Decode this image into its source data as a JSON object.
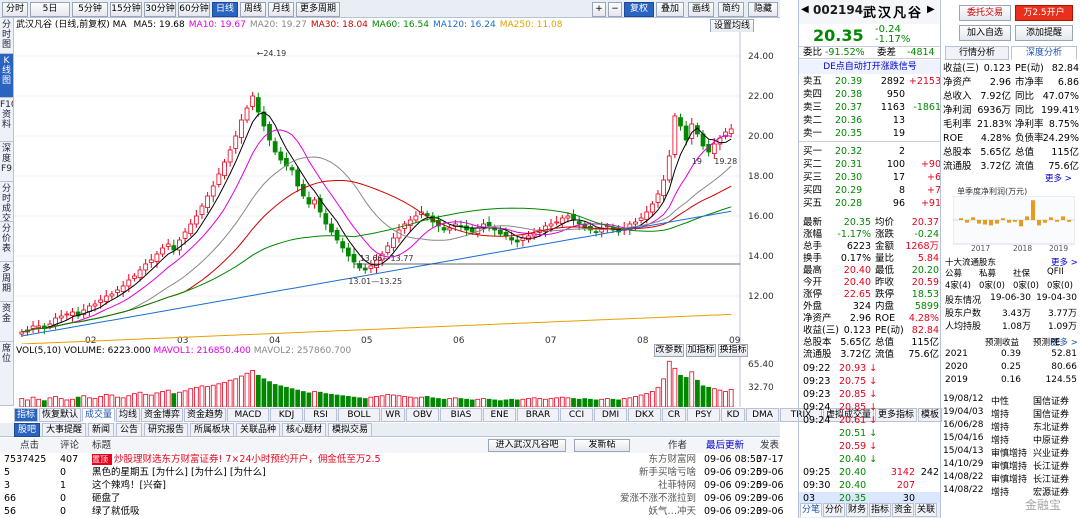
{
  "toolbar": {
    "periods": [
      "分时",
      "5日",
      "5分钟",
      "15分钟",
      "30分钟",
      "60分钟",
      "日线",
      "周线",
      "月线",
      "更多周期"
    ],
    "active_period": "日线",
    "right_buttons": [
      "复权",
      "叠加",
      "画线",
      "简约",
      "隐藏"
    ],
    "right_icons": [
      "plus-icon",
      "minus-icon",
      "left-icon",
      "right-icon"
    ]
  },
  "left_sidebar": [
    "分时图",
    "K线图",
    "F10资料",
    "深度F9",
    "分时成交",
    "分价表",
    "多周期",
    "资金",
    "席位"
  ],
  "chart_header": {
    "stock": "武汉凡谷",
    "mode": "(日线,前复权)",
    "ma_label": "MA",
    "mas": [
      {
        "label": "MA5:",
        "value": "19.68",
        "color": "#000000"
      },
      {
        "label": "MA10:",
        "value": "19.67",
        "color": "#e000e0"
      },
      {
        "label": "MA20:",
        "value": "19.27",
        "color": "#888888"
      },
      {
        "label": "MA30:",
        "value": "18.04",
        "color": "#d00000"
      },
      {
        "label": "MA60:",
        "value": "16.54",
        "color": "#008800"
      },
      {
        "label": "MA120:",
        "value": "16.24",
        "color": "#1a6fd0"
      },
      {
        "label": "MA250:",
        "value": "11.08",
        "color": "#e8a000"
      }
    ],
    "settings_btn": "设置均线"
  },
  "chart_data": [
    {
      "type": "candlestick",
      "title": "武汉凡谷(日线,前复权)",
      "x_labels": [
        "02",
        "03",
        "04",
        "05",
        "06",
        "07",
        "08",
        "09"
      ],
      "y_ticks": [
        "24.00",
        "22.00",
        "20.00",
        "18.00",
        "16.00",
        "14.00",
        "12.00"
      ],
      "ylim": [
        10,
        24.6
      ],
      "annotations": [
        "24.19",
        "13.66—13.77",
        "13.01—13.25",
        "19.28",
        "19"
      ],
      "closes": [
        10.2,
        10.3,
        10.5,
        10.5,
        10.4,
        10.6,
        10.9,
        11.0,
        11.1,
        11.2,
        11.0,
        11.3,
        11.5,
        11.6,
        11.8,
        12.0,
        12.1,
        12.3,
        12.5,
        12.8,
        13.0,
        13.3,
        13.6,
        13.8,
        14.1,
        14.4,
        14.6,
        14.3,
        14.8,
        15.2,
        15.6,
        16.0,
        16.5,
        17.0,
        17.5,
        18.1,
        18.7,
        19.3,
        20.0,
        20.8,
        21.4,
        22.0,
        21.2,
        20.5,
        19.8,
        19.2,
        18.8,
        18.5,
        18.3,
        17.5,
        17.0,
        16.6,
        16.8,
        16.2,
        15.6,
        15.2,
        14.8,
        14.4,
        14.0,
        13.7,
        13.4,
        13.3,
        13.5,
        13.8,
        14.1,
        14.5,
        14.9,
        15.3,
        15.6,
        15.8,
        16.0,
        16.2,
        16.0,
        15.7,
        15.5,
        15.3,
        15.4,
        15.6,
        15.5,
        15.3,
        15.2,
        15.4,
        15.6,
        15.5,
        15.3,
        15.1,
        15.0,
        14.8,
        14.7,
        14.9,
        15.0,
        15.1,
        15.3,
        15.5,
        15.6,
        15.7,
        15.9,
        16.0,
        15.8,
        15.6,
        15.4,
        15.3,
        15.2,
        15.4,
        15.5,
        15.3,
        15.2,
        15.4,
        15.6,
        15.7,
        15.9,
        16.2,
        16.6,
        17.1,
        17.8,
        19.0,
        21.0,
        20.5,
        19.8,
        20.6,
        20.1,
        19.5,
        19.2,
        19.6,
        19.9,
        20.2,
        20.35
      ],
      "series": [
        {
          "name": "MA5",
          "value": "19.68",
          "color": "#000000"
        },
        {
          "name": "MA10",
          "value": "19.67",
          "color": "#e000e0"
        },
        {
          "name": "MA20",
          "value": "19.27",
          "color": "#888888"
        },
        {
          "name": "MA30",
          "value": "18.04",
          "color": "#d00000"
        },
        {
          "name": "MA60",
          "value": "16.54",
          "color": "#008800"
        },
        {
          "name": "MA120",
          "value": "16.24",
          "color": "#1a6fd0"
        },
        {
          "name": "MA250",
          "value": "11.08",
          "color": "#e8a000"
        }
      ]
    },
    {
      "type": "bar",
      "title": "VOL(5,10)",
      "y_ticks": [
        "65.40",
        "32.70"
      ],
      "values": [
        12,
        10,
        14,
        11,
        9,
        13,
        15,
        12,
        10,
        11,
        14,
        16,
        13,
        12,
        15,
        18,
        17,
        14,
        13,
        16,
        19,
        21,
        18,
        17,
        20,
        22,
        24,
        19,
        21,
        23,
        26,
        28,
        30,
        29,
        31,
        33,
        35,
        38,
        40,
        44,
        48,
        52,
        45,
        40,
        36,
        32,
        30,
        28,
        26,
        24,
        22,
        20,
        22,
        21,
        19,
        18,
        17,
        16,
        15,
        14,
        13,
        12,
        14,
        15,
        16,
        18,
        17,
        16,
        15,
        14,
        13,
        14,
        15,
        13,
        12,
        11,
        12,
        13,
        12,
        11,
        10,
        11,
        12,
        11,
        10,
        9,
        10,
        11,
        10,
        11,
        12,
        13,
        12,
        11,
        12,
        13,
        14,
        13,
        12,
        11,
        12,
        11,
        10,
        11,
        12,
        11,
        10,
        12,
        13,
        15,
        17,
        19,
        22,
        28,
        40,
        65,
        55,
        45,
        42,
        50,
        38,
        30,
        28,
        26,
        24,
        22,
        25
      ]
    }
  ],
  "vol_header": {
    "vol_label": "VOL(5,10)",
    "volume_label": "VOLUME: 6223.000",
    "mavol1": "MAVOL1: 216850.400",
    "mavol2": "MAVOL2: 257860.700",
    "buttons": [
      "改参数",
      "加指标",
      "换指标"
    ]
  },
  "vol_ticks": [
    "65.40",
    "32.70"
  ],
  "x_labels": [
    "02",
    "03",
    "04",
    "05",
    "06",
    "07",
    "08",
    "09"
  ],
  "indicator_tabs": [
    "指标",
    "恢复默认",
    "成交量",
    "均线",
    "资金博弈",
    "资金趋势",
    "MACD",
    "KDJ",
    "RSI",
    "BOLL",
    "WR",
    "OBV",
    "BIAS",
    "ENE",
    "BRAR",
    "CCI",
    "DMI",
    "DKX",
    "CR",
    "PSY",
    "KD",
    "DMA",
    "TRIX",
    "虚拟成交量",
    "更多指标",
    "模板"
  ],
  "news_tabs": [
    "股吧",
    "大事提醒",
    "新闻",
    "公告",
    "研究报告",
    "所属板块",
    "关联品种",
    "核心题材",
    "模拟交易"
  ],
  "forum": {
    "columns": [
      "点击",
      "评论",
      "标题",
      "作者",
      "最后更新",
      "发表日"
    ],
    "buttons": [
      "进入武汉凡谷吧",
      "发新帖"
    ],
    "rows": [
      {
        "clicks": "7537425",
        "comments": "407",
        "badge": "置顶",
        "title": "炒股理财选东方财富证券! 7×24小时预约开户，佣金低至万2.5",
        "author": "东方财富网",
        "updated": "09-06 08:53",
        "posted": "07-17"
      },
      {
        "clicks": "5",
        "comments": "0",
        "badge": "",
        "title": "黑色的星期五 [为什么] [为什么] [为什么]",
        "author": "新手买啥亏啥",
        "updated": "09-06 09:25",
        "posted": "09-06"
      },
      {
        "clicks": "3",
        "comments": "1",
        "badge": "",
        "title": "这个辣鸡！[兴奋]",
        "author": "社菲特网",
        "updated": "09-06 09:25",
        "posted": "09-06"
      },
      {
        "clicks": "66",
        "comments": "0",
        "badge": "",
        "title": "砸盘了",
        "author": "爱涨不涨不涨拉到",
        "updated": "09-06 09:23",
        "posted": "09-06"
      },
      {
        "clicks": "56",
        "comments": "0",
        "badge": "",
        "title": "绿了就低吸",
        "author": "妖气…冲天",
        "updated": "09-06 09:23",
        "posted": "09-06"
      }
    ]
  },
  "quote": {
    "code": "002194",
    "name": "武汉凡谷",
    "btn_watch": "委托交易",
    "btn_open": "万2.5开户",
    "btn_add": "加入自选",
    "btn_alert": "添加提醒",
    "price": "20.35",
    "change": "-0.24",
    "change_pct": "-1.17%",
    "weibi_label": "委比",
    "weibi": "-91.52%",
    "weicha_label": "委差",
    "weicha": "-4814",
    "banner": "DE点自动打开涨跌信号",
    "sells": [
      {
        "label": "卖五",
        "price": "20.39",
        "vol": "2892",
        "chg": "+2153"
      },
      {
        "label": "卖四",
        "price": "20.38",
        "vol": "950",
        "chg": ""
      },
      {
        "label": "卖三",
        "price": "20.37",
        "vol": "1163",
        "chg": "-1861"
      },
      {
        "label": "卖二",
        "price": "20.36",
        "vol": "13",
        "chg": ""
      },
      {
        "label": "卖一",
        "price": "20.35",
        "vol": "19",
        "chg": ""
      }
    ],
    "buys": [
      {
        "label": "买一",
        "price": "20.32",
        "vol": "2",
        "chg": ""
      },
      {
        "label": "买二",
        "price": "20.31",
        "vol": "100",
        "chg": "+90"
      },
      {
        "label": "买三",
        "price": "20.30",
        "vol": "17",
        "chg": "+6"
      },
      {
        "label": "买四",
        "price": "20.29",
        "vol": "8",
        "chg": "+7"
      },
      {
        "label": "买五",
        "price": "20.28",
        "vol": "96",
        "chg": "+91"
      }
    ],
    "stats": [
      [
        "最新",
        "20.35",
        "均价",
        "20.37"
      ],
      [
        "涨幅",
        "-1.17%",
        "涨跌",
        "-0.24"
      ],
      [
        "总手",
        "6223",
        "金额",
        "1268万"
      ],
      [
        "换手",
        "0.17%",
        "量比",
        "5.84"
      ],
      [
        "最高",
        "20.40",
        "最低",
        "20.20"
      ],
      [
        "今开",
        "20.40",
        "昨收",
        "20.59"
      ],
      [
        "涨停",
        "22.65",
        "跌停",
        "18.53"
      ],
      [
        "外盘",
        "324",
        "内盘",
        "5899"
      ],
      [
        "净资产",
        "2.96",
        "ROE",
        "4.28%"
      ],
      [
        "收益(三)",
        "0.123",
        "PE(动)",
        "82.84"
      ],
      [
        "总股本",
        "5.65亿",
        "总值",
        "115亿"
      ],
      [
        "流通股",
        "3.72亿",
        "流值",
        "75.6亿"
      ]
    ],
    "ticks": [
      {
        "time": "09:22",
        "price": "20.93",
        "vol": "",
        "flag": ""
      },
      {
        "time": "09:23",
        "price": "20.75",
        "vol": "",
        "flag": ""
      },
      {
        "time": "09:23",
        "price": "20.85",
        "vol": "",
        "flag": ""
      },
      {
        "time": "09:24",
        "price": "20.85",
        "vol": "",
        "flag": ""
      },
      {
        "time": "09:24",
        "price": "20.61",
        "vol": "",
        "flag": ""
      },
      {
        "time": "",
        "price": "20.51",
        "vol": "",
        "flag": ""
      },
      {
        "time": "",
        "price": "20.59",
        "vol": "",
        "flag": ""
      },
      {
        "time": "",
        "price": "20.40",
        "vol": "",
        "flag": ""
      },
      {
        "time": "09:25",
        "price": "20.40",
        "vol": "3142",
        "flag": "242"
      },
      {
        "time": "09:30",
        "price": "20.40",
        "vol": "207",
        "flag": ""
      }
    ],
    "last_tick": {
      "time": "03",
      "price": "20.35",
      "vol": "30"
    },
    "bottom_tabs": [
      "分笔",
      "分价",
      "财务",
      "指标",
      "资金",
      "关联"
    ]
  },
  "f10": {
    "tabs": [
      "行情分析",
      "深度分析"
    ],
    "rows": [
      [
        "收益(三)",
        "0.123",
        "PE(动)",
        "82.84"
      ],
      [
        "净资产",
        "2.96",
        "市净率",
        "6.86"
      ],
      [
        "总收入",
        "7.92亿",
        "同比",
        "47.07%"
      ],
      [
        "净利润",
        "6936万",
        "同比",
        "199.41%"
      ],
      [
        "毛利率",
        "21.83%",
        "净利率",
        "8.75%"
      ],
      [
        "ROE",
        "4.28%",
        "负债率",
        "24.29%"
      ],
      [
        "总股本",
        "5.65亿",
        "总值",
        "115亿"
      ],
      [
        "流通股",
        "3.72亿",
        "流值",
        "75.6亿"
      ]
    ],
    "chart_more": "更多 >",
    "chart_title": "单季度净利润(万元)",
    "chart_years": [
      "2017",
      "2018",
      "2019"
    ],
    "holders_title": "十大流通股东",
    "holders_more": "更多 >",
    "holders_head": [
      "公募",
      "私募",
      "社保",
      "QFII"
    ],
    "holders_vals": [
      "4家(4)",
      "0家(0)",
      "0家(0)",
      "0家(0)"
    ],
    "holder_rows": [
      [
        "股东情况",
        "19-06-30",
        "19-04-30"
      ],
      [
        "股东户数",
        "3.43万",
        "3.77万"
      ],
      [
        "人均持股",
        "1.08万",
        "1.09万"
      ]
    ],
    "forecast_title": "预测收益",
    "forecast_more": "更多 >",
    "forecast_head": [
      "",
      "预测收益",
      "预测PE"
    ],
    "forecast_rows": [
      [
        "2021",
        "0.39",
        "52.81"
      ],
      [
        "2020",
        "0.25",
        "80.66"
      ],
      [
        "2019",
        "0.16",
        "124.55"
      ]
    ],
    "ratings": [
      [
        "19/08/12",
        "中性",
        "国信证券"
      ],
      [
        "19/04/03",
        "增持",
        "国信证券"
      ],
      [
        "16/06/28",
        "增持",
        "东北证券"
      ],
      [
        "15/04/16",
        "增持",
        "中原证券"
      ],
      [
        "15/04/13",
        "审慎增持",
        "兴业证券"
      ],
      [
        "14/10/29",
        "审慎增持",
        "长江证券"
      ],
      [
        "14/08/22",
        "审慎增持",
        "长江证券"
      ],
      [
        "14/08/22",
        "增持",
        "宏源证券"
      ]
    ]
  },
  "watermark": "金融宝"
}
